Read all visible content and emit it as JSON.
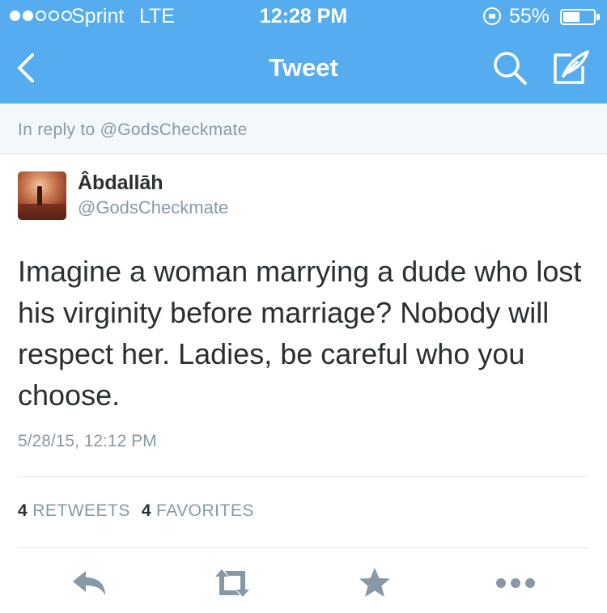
{
  "status_bar": {
    "signal_bars_filled": 2,
    "signal_bars_total": 5,
    "carrier": "Sprint",
    "network": "LTE",
    "time": "12:28 PM",
    "battery_percent": "55%",
    "battery_level": 0.55
  },
  "nav": {
    "title": "Tweet",
    "back_icon": "chevron-left-icon",
    "search_icon": "search-icon",
    "compose_icon": "compose-tweet-icon"
  },
  "reply_context": {
    "text": "In reply to @GodsCheckmate"
  },
  "tweet": {
    "author_name": "Âbdallāh",
    "author_handle": "@GodsCheckmate",
    "text": "Imagine a woman marrying a dude who lost his virginity before marriage? Nobody will respect her. Ladies, be careful who you choose.",
    "timestamp": "5/28/15, 12:12 PM",
    "retweets_count": "4",
    "retweets_label": "RETWEETS",
    "favorites_count": "4",
    "favorites_label": "FAVORITES"
  },
  "actions": [
    {
      "icon": "reply-icon"
    },
    {
      "icon": "retweet-icon"
    },
    {
      "icon": "favorite-star-icon"
    },
    {
      "icon": "more-dots-icon"
    }
  ],
  "colors": {
    "brand": "#55acee",
    "text": "#292f33",
    "muted": "#8899a6",
    "icon": "#8899a6"
  }
}
